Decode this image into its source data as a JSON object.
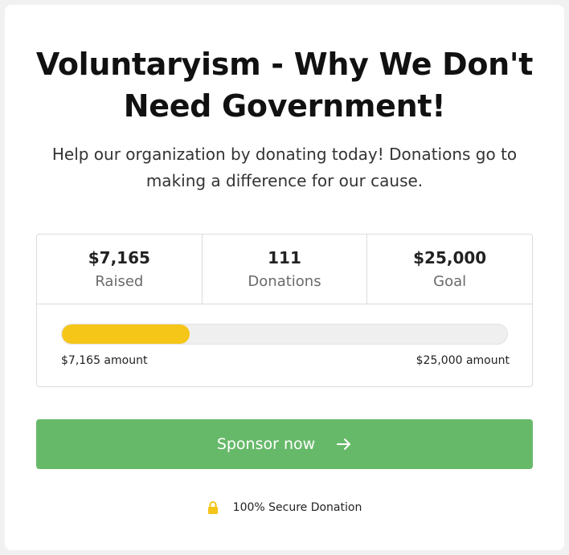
{
  "page": {
    "title": "Voluntaryism - Why We Don't Need Government!",
    "subtitle": "Help our organization by donating today! Donations go to making a difference for our cause."
  },
  "stats": [
    {
      "value": "$7,165",
      "label": "Raised"
    },
    {
      "value": "111",
      "label": "Donations"
    },
    {
      "value": "$25,000",
      "label": "Goal"
    }
  ],
  "progress": {
    "fraction": 0.2866,
    "left_label": "$7,165 amount",
    "right_label": "$25,000 amount"
  },
  "sponsor_button": {
    "label": "Sponsor now",
    "icon": "arrow-right-icon"
  },
  "secure": {
    "label": "100% Secure Donation",
    "icon": "lock-icon"
  },
  "colors": {
    "button": "#67b96a",
    "progress_fill": "#f5c518",
    "lock": "#f5c518"
  }
}
